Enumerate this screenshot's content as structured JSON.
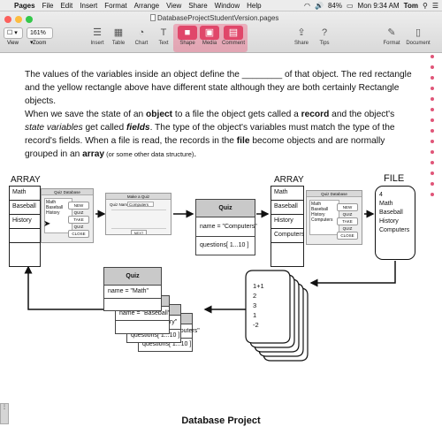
{
  "menubar": {
    "app": "Pages",
    "items": [
      "File",
      "Edit",
      "Insert",
      "Format",
      "Arrange",
      "View",
      "Share",
      "Window",
      "Help"
    ],
    "battery": "84%",
    "clock": "Mon 9:34 AM",
    "user": "Tom"
  },
  "window": {
    "title": "DatabaseProjectStudentVersion.pages",
    "zoom_value": "161%",
    "view_label": "View",
    "zoom_label": "Zoom"
  },
  "toolbar": {
    "insert": "Insert",
    "table": "Table",
    "chart": "Chart",
    "text": "Text",
    "shape": "Shape",
    "media": "Media",
    "comment": "Comment",
    "share": "Share",
    "tips": "Tips",
    "format": "Format",
    "document": "Document"
  },
  "paragraphs": {
    "p1": "The values of the variables inside an object define the ________ of that object. The red rectangle and the yellow rectangle above have different state although they are both certainly Rectangle objects.",
    "p2a": "When we save the state of an ",
    "p2b": "object",
    "p2c": " to a file the object gets called a ",
    "p2d": "record",
    "p2e": " and the object's ",
    "p2f": "state variables",
    "p2g": " get called ",
    "p2h": "fields",
    "p2i": ".  The type of the object's variables must match the type of the record's fields. When a file is read, the records in the ",
    "p2j": "file",
    "p2k": " become objects and are normally grouped in an ",
    "p2l": "array",
    "p2m": " (or some other data structure)",
    "p2n": "."
  },
  "diagram": {
    "array_label_left": "ARRAY",
    "array_label_right": "ARRAY",
    "file_label": "FILE",
    "left_array": [
      "Math",
      "Baseball",
      "History",
      "",
      "",
      ""
    ],
    "right_array": [
      "Math",
      "Baseball",
      "History",
      "Computers",
      "",
      ""
    ],
    "quiz_center": {
      "title": "Quiz",
      "name": "name = \"Computers\"",
      "questions": "questions[ 1...10 ]"
    },
    "quiz_stack": {
      "title": "Quiz",
      "rows": [
        "name = \"Math\"",
        "name = \"Baseball\"",
        "name = \"History\"",
        "name = \"Computers\"",
        "questions[ 1...10 ]",
        "questions[ 1...10 ]"
      ]
    },
    "file_contents": [
      "4",
      "Math",
      "Baseball",
      "History",
      "Computers"
    ],
    "records": [
      "1+1",
      "2",
      "3",
      "1",
      "-2"
    ],
    "win_title": "Quiz Database",
    "win_list": [
      "Math",
      "Baseball",
      "History"
    ],
    "win_list_right": [
      "Math",
      "Baseball",
      "History",
      "Computers"
    ],
    "win_buttons": [
      "NEW QUIZ",
      "TAKE QUIZ",
      "CLOSE"
    ],
    "make_quiz_title": "Make a Quiz",
    "make_quiz_field": "Quiz Name",
    "make_quiz_value": "Computers",
    "make_quiz_next": "NEXT"
  },
  "footer": {
    "title": "Database Project"
  }
}
